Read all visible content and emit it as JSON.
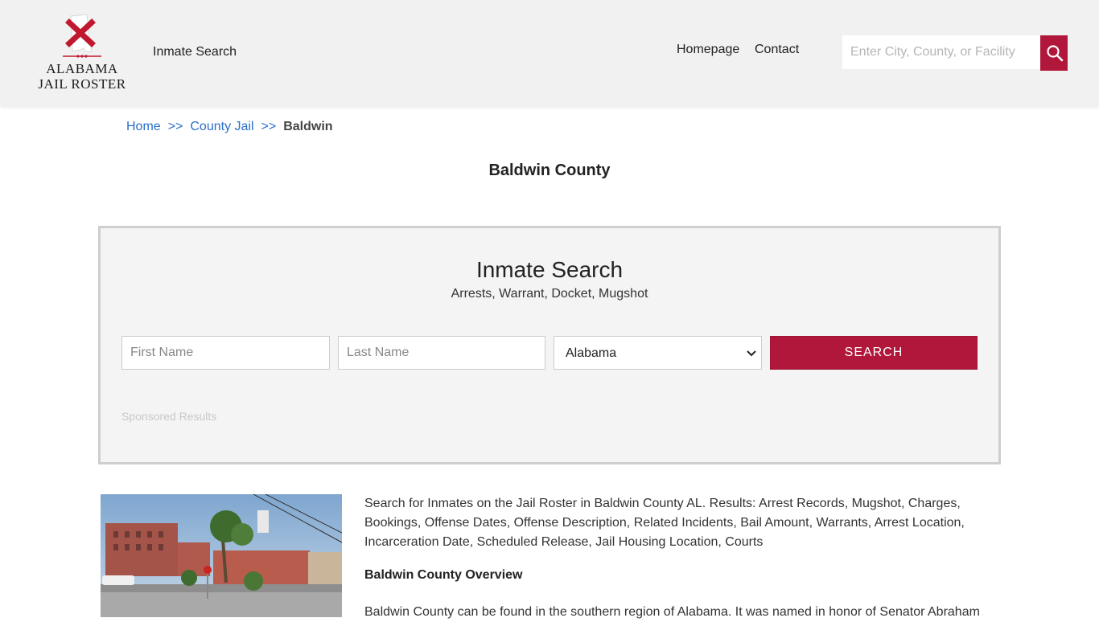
{
  "header": {
    "logo_line1": "ALABAMA",
    "logo_line2": "JAIL ROSTER",
    "nav_inmate_search": "Inmate Search",
    "nav_homepage": "Homepage",
    "nav_contact": "Contact",
    "search_placeholder": "Enter City, County, or Facility",
    "search_icon": "magnifier-icon",
    "accent_color": "#b0173a"
  },
  "breadcrumb": {
    "home": "Home",
    "sep": ">>",
    "county_jail": "County Jail",
    "current": "Baldwin"
  },
  "page_title": "Baldwin County",
  "search_box": {
    "title": "Inmate Search",
    "subtitle": "Arrests, Warrant, Docket, Mugshot",
    "first_name_placeholder": "First Name",
    "last_name_placeholder": "Last Name",
    "state_selected": "Alabama",
    "search_button": "SEARCH",
    "sponsored": "Sponsored Results"
  },
  "content": {
    "description": "Search for Inmates on the Jail Roster in Baldwin County AL. Results: Arrest Records, Mugshot, Charges, Bookings, Offense Dates, Offense Description, Related Incidents, Bail Amount, Warrants, Arrest Location, Incarceration Date, Scheduled Release, Jail Housing Location, Courts",
    "overview_heading": "Baldwin County Overview",
    "overview_text": "Baldwin County can be found in the southern region of Alabama. It was named in honor of Senator Abraham"
  }
}
